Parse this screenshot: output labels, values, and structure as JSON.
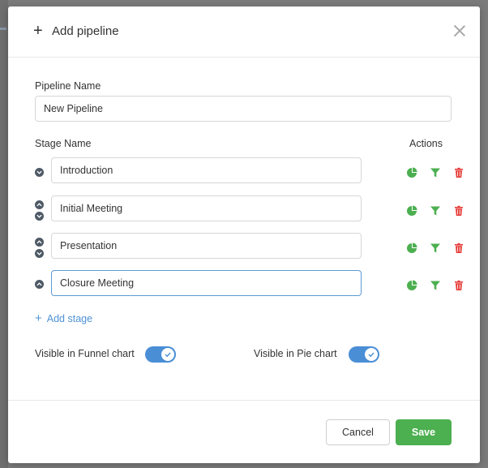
{
  "modal": {
    "title": "Add pipeline",
    "pipeline_name_label": "Pipeline Name",
    "pipeline_name_value": "New Pipeline",
    "stage_name_label": "Stage Name",
    "actions_label": "Actions",
    "stages": [
      {
        "name": "Introduction"
      },
      {
        "name": "Initial Meeting"
      },
      {
        "name": "Presentation"
      },
      {
        "name": "Closure Meeting"
      }
    ],
    "add_stage_label": "Add stage",
    "funnel_toggle_label": "Visible in Funnel chart",
    "funnel_toggle_on": true,
    "pie_toggle_label": "Visible in Pie chart",
    "pie_toggle_on": true,
    "cancel_label": "Cancel",
    "save_label": "Save"
  },
  "colors": {
    "accent_blue": "#4a8ed6",
    "save_green": "#4caf50",
    "action_green": "#4caf50",
    "delete_red": "#e53935"
  },
  "icons": [
    "plus-icon",
    "close-icon",
    "chevron-up-icon",
    "chevron-down-icon",
    "pie-chart-icon",
    "filter-icon",
    "trash-icon",
    "check-icon"
  ]
}
